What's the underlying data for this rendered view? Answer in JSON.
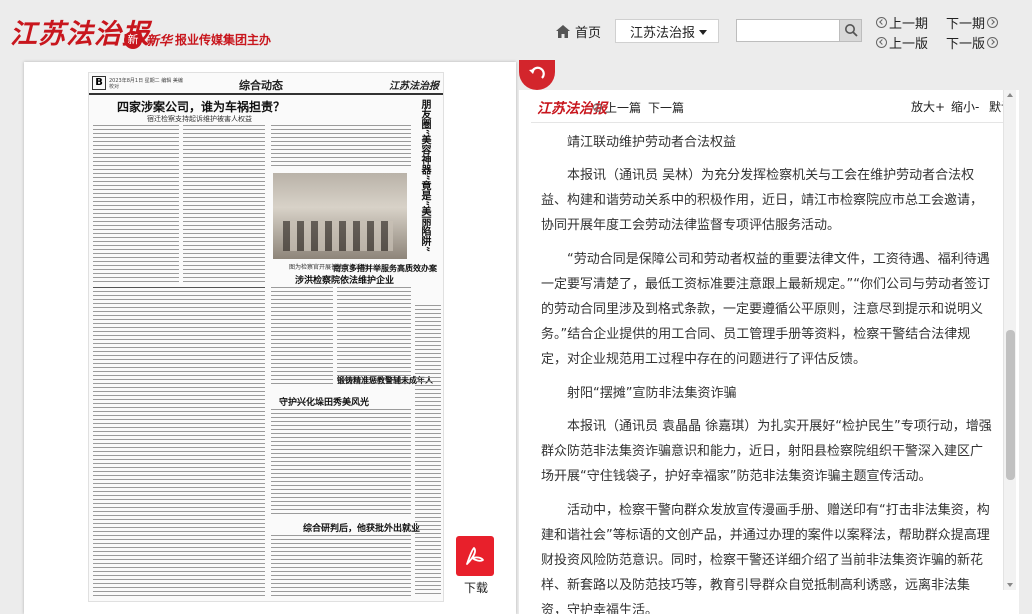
{
  "header": {
    "logo_text": "江苏法治报",
    "sponsor_mark": "新",
    "sponsor_brand": "新华",
    "sponsor_text": "报业传媒集团主办",
    "home_label": "首页",
    "paper_select_value": "江苏法治报",
    "search_placeholder": "",
    "prev_issue": "上一期",
    "next_issue": "下一期",
    "prev_page": "上一版",
    "next_page": "下一版"
  },
  "newspaper": {
    "page_letter": "B",
    "date_line": "2023年8月1日 星期二 编辑 美编 校对",
    "section": "综合动态",
    "masthead": "江苏法治报",
    "headline_1": "四家涉案公司，谁为车祸担责？",
    "headline_1_sub": "宿迁检察支持起诉维护被害人权益",
    "headline_2": "涉洪检察院依法维护企业",
    "headline_3": "南京多措并举服务高质效办案",
    "headline_4": "守护兴化垛田秀美风光",
    "headline_5": "锻铸精准惩教警辅未成年人",
    "headline_6": "综合研判后，他获批外出就业",
    "vertical_head": "朋友圈“美容神器”竟是“美丽陷阱”",
    "photo_caption": "图为检察官开展普法宣传活动"
  },
  "download": {
    "label": "下载"
  },
  "reader": {
    "logo_text": "江苏法治报",
    "prev_article": "上一篇",
    "next_article": "下一篇",
    "zoom_in": "放大+",
    "zoom_out": "缩小-",
    "zoom_default": "默认",
    "paragraphs": [
      "靖江联动维护劳动者合法权益",
      "本报讯（通讯员 吴林）为充分发挥检察机关与工会在维护劳动者合法权益、构建和谐劳动关系中的积极作用，近日，靖江市检察院应市总工会邀请，协同开展年度工会劳动法律监督专项评估服务活动。",
      "“劳动合同是保障公司和劳动者权益的重要法律文件，工资待遇、福利待遇一定要写清楚了，最低工资标准要注意跟上最新规定。”“你们公司与劳动者签订的劳动合同里涉及到格式条款，一定要遵循公平原则，注意尽到提示和说明义务。”结合企业提供的用工合同、员工管理手册等资料，检察干警结合法律规定，对企业规范用工过程中存在的问题进行了评估反馈。",
      "射阳“摆摊”宣防非法集资诈骗",
      "本报讯（通讯员 袁晶晶 徐嘉琪）为扎实开展好“检护民生”专项行动，增强群众防范非法集资诈骗意识和能力，近日，射阳县检察院组织干警深入建区广场开展“守住钱袋子，护好幸福家”防范非法集资诈骗主题宣传活动。",
      "活动中，检察干警向群众发放宣传漫画手册、赠送印有“打击非法集资，构建和谐社会”等标语的文创产品，并通过办理的案件以案释法，帮助群众提高理财投资风险防范意识。同时，检察干警还详细介绍了当前非法集资诈骗的新花样、新套路以及防范技巧等，教育引导群众自觉抵制高利诱惑，远离非法集资，守护幸福生活。"
    ],
    "scroll_position": 0.7
  },
  "colors": {
    "brand_red": "#c8161d",
    "pdf_red": "#e8202b",
    "back_red": "#d3252c"
  }
}
